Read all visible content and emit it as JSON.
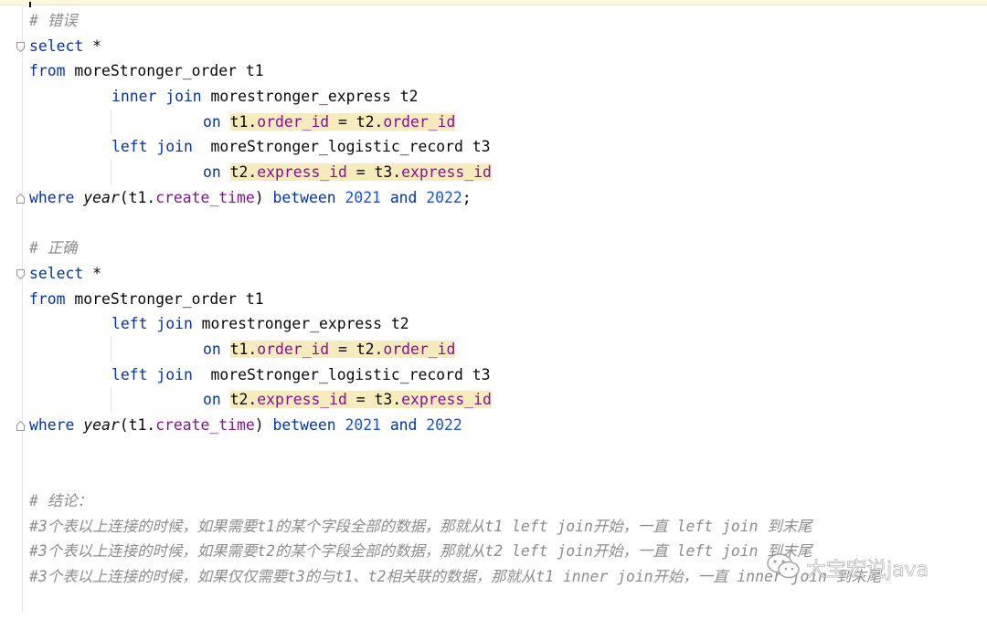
{
  "editor": {
    "l1": "# 错误",
    "l2_kw": "select",
    "l2_rest": " *",
    "l3_kw": "from",
    "l3_rest": " moreStronger_order t1",
    "l4_kw": "inner join",
    "l4_rest": " morestronger_express t2",
    "l5_kw": "on",
    "l5_sp": " ",
    "l5_a": "t1.",
    "l5_b": "order_id",
    "l5_c": " = t2.",
    "l5_d": "order_id",
    "l6_kw": "left join",
    "l6_rest": "  moreStronger_logistic_record t3",
    "l7_kw": "on",
    "l7_sp": " ",
    "l7_a": "t2.",
    "l7_b": "express_id",
    "l7_c": " = t3.",
    "l7_d": "express_id",
    "l8_kw": "where",
    "l8_sp": " ",
    "l8_fn": "year",
    "l8_p1": "(t1.",
    "l8_fld": "create_time",
    "l8_p2": ") ",
    "l8_bt": "between",
    "l8_n1": "2021",
    "l8_and": "and",
    "l8_n2": "2022",
    "l8_end": ";",
    "l10": "# 正确",
    "l11_kw": "select",
    "l11_rest": " *",
    "l12_kw": "from",
    "l12_rest": " moreStronger_order t1",
    "l13_kw": "left join",
    "l13_rest": " morestronger_express t2",
    "l14_kw": "on",
    "l14_sp": " ",
    "l14_a": "t1.",
    "l14_b": "order_id",
    "l14_c": " = t2.",
    "l14_d": "order_id",
    "l15_kw": "left join",
    "l15_rest": "  moreStronger_logistic_record t3",
    "l16_kw": "on",
    "l16_sp": " ",
    "l16_a": "t2.",
    "l16_b": "express_id",
    "l16_c": " = t3.",
    "l16_d": "express_id",
    "l17_kw": "where",
    "l17_sp": " ",
    "l17_fn": "year",
    "l17_p1": "(t1.",
    "l17_fld": "create_time",
    "l17_p2": ") ",
    "l17_bt": "between",
    "l17_n1": "2021",
    "l17_and": "and",
    "l17_n2": "2022",
    "l20": "# 结论：",
    "l21": "#3个表以上连接的时候，如果需要t1的某个字段全部的数据，那就从t1 left join开始，一直 left join 到末尾",
    "l22": "#3个表以上连接的时候，如果需要t2的某个字段全部的数据，那就从t2 left join开始，一直 left join 到末尾",
    "l23": "#3个表以上连接的时候，如果仅仅需要t3的与t1、t2相关联的数据，那就从t1 inner join开始，一直 inner join 到末尾"
  },
  "watermark": {
    "text": "大宝宏说java",
    "icon": "wechat-icon"
  },
  "colors": {
    "keyword": "#0033b3",
    "field": "#871094",
    "number": "#1750eb",
    "comment": "#8c8c8c",
    "highlight": "#f6ebbc"
  }
}
